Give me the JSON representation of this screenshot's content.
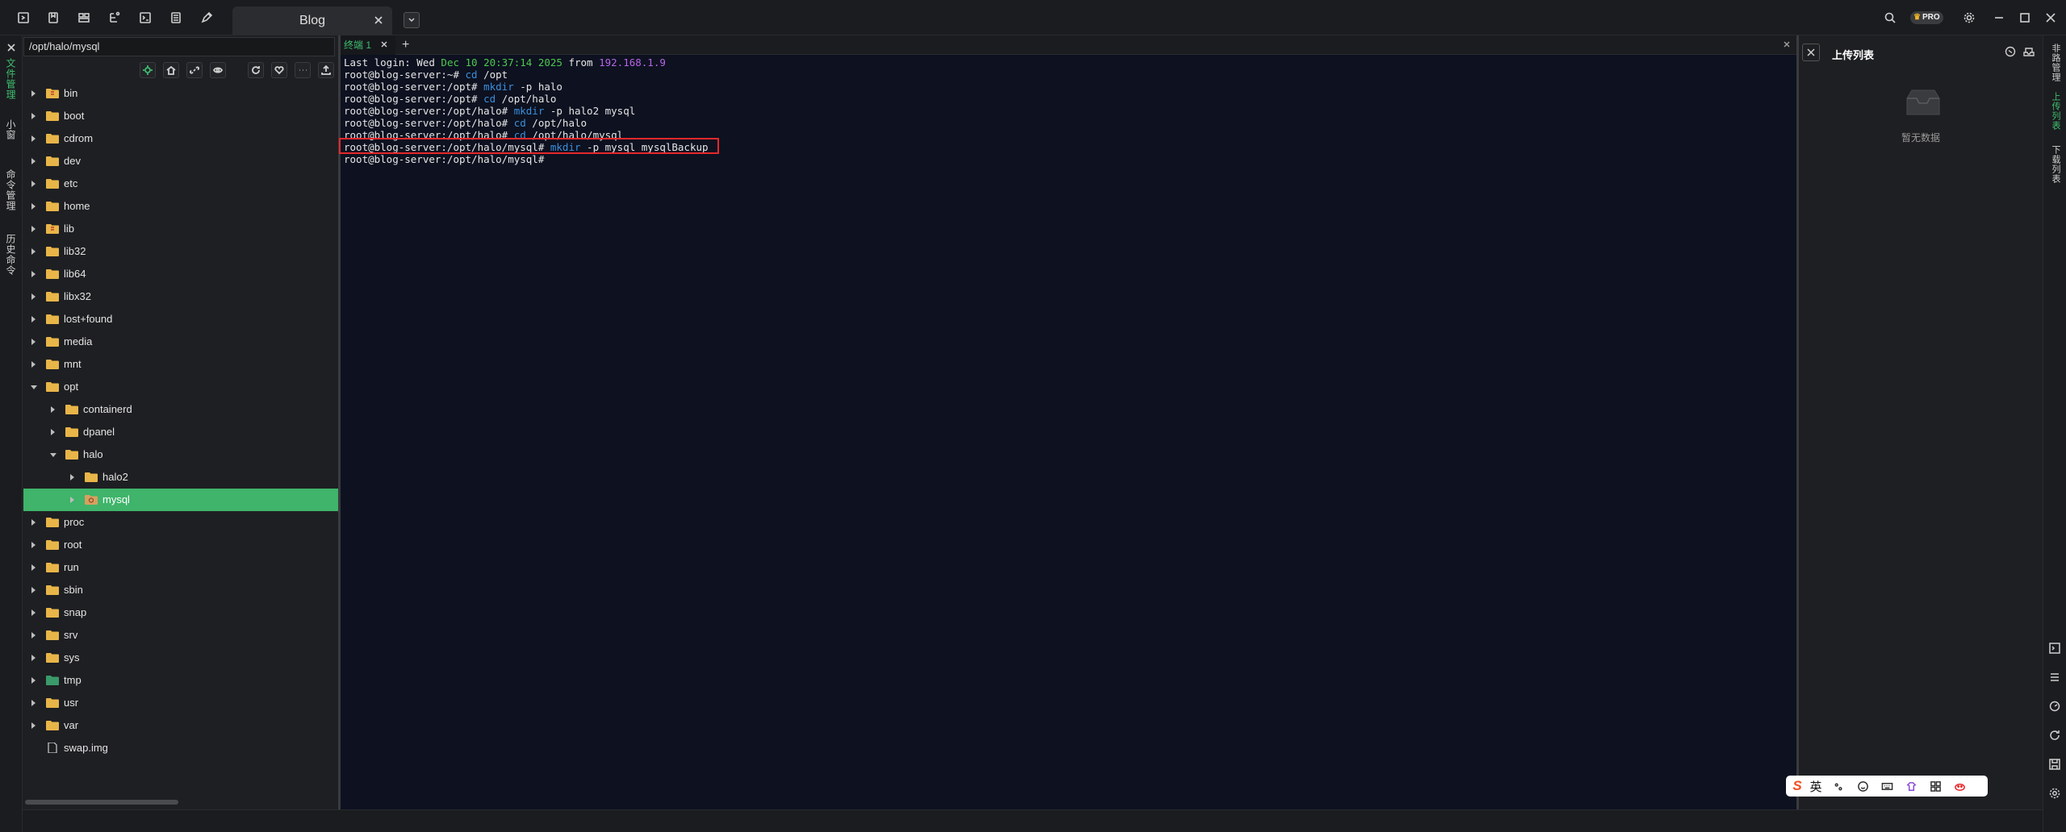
{
  "session_tab": {
    "title": "Blog"
  },
  "pro_badge": "PRO",
  "left_rail": {
    "tabs": [
      {
        "label": "文件管理",
        "active": true
      },
      {
        "label": "小窗",
        "active": false
      },
      {
        "label": "命令管理",
        "active": false
      },
      {
        "label": "历史命令",
        "active": false
      }
    ]
  },
  "file_panel": {
    "path": "/opt/halo/mysql",
    "tree": [
      {
        "name": "bin",
        "depth": 0,
        "expandable": true,
        "expanded": false,
        "type": "folder-link"
      },
      {
        "name": "boot",
        "depth": 0,
        "expandable": true,
        "expanded": false,
        "type": "folder"
      },
      {
        "name": "cdrom",
        "depth": 0,
        "expandable": true,
        "expanded": false,
        "type": "folder"
      },
      {
        "name": "dev",
        "depth": 0,
        "expandable": true,
        "expanded": false,
        "type": "folder"
      },
      {
        "name": "etc",
        "depth": 0,
        "expandable": true,
        "expanded": false,
        "type": "folder"
      },
      {
        "name": "home",
        "depth": 0,
        "expandable": true,
        "expanded": false,
        "type": "folder"
      },
      {
        "name": "lib",
        "depth": 0,
        "expandable": true,
        "expanded": false,
        "type": "folder-link"
      },
      {
        "name": "lib32",
        "depth": 0,
        "expandable": true,
        "expanded": false,
        "type": "folder"
      },
      {
        "name": "lib64",
        "depth": 0,
        "expandable": true,
        "expanded": false,
        "type": "folder"
      },
      {
        "name": "libx32",
        "depth": 0,
        "expandable": true,
        "expanded": false,
        "type": "folder"
      },
      {
        "name": "lost+found",
        "depth": 0,
        "expandable": true,
        "expanded": false,
        "type": "folder"
      },
      {
        "name": "media",
        "depth": 0,
        "expandable": true,
        "expanded": false,
        "type": "folder"
      },
      {
        "name": "mnt",
        "depth": 0,
        "expandable": true,
        "expanded": false,
        "type": "folder"
      },
      {
        "name": "opt",
        "depth": 0,
        "expandable": true,
        "expanded": true,
        "type": "folder"
      },
      {
        "name": "containerd",
        "depth": 1,
        "expandable": true,
        "expanded": false,
        "type": "folder"
      },
      {
        "name": "dpanel",
        "depth": 1,
        "expandable": true,
        "expanded": false,
        "type": "folder"
      },
      {
        "name": "halo",
        "depth": 1,
        "expandable": true,
        "expanded": true,
        "type": "folder"
      },
      {
        "name": "halo2",
        "depth": 2,
        "expandable": true,
        "expanded": false,
        "type": "folder"
      },
      {
        "name": "mysql",
        "depth": 2,
        "expandable": true,
        "expanded": false,
        "type": "folder-special",
        "selected": true
      },
      {
        "name": "proc",
        "depth": 0,
        "expandable": true,
        "expanded": false,
        "type": "folder"
      },
      {
        "name": "root",
        "depth": 0,
        "expandable": true,
        "expanded": false,
        "type": "folder"
      },
      {
        "name": "run",
        "depth": 0,
        "expandable": true,
        "expanded": false,
        "type": "folder"
      },
      {
        "name": "sbin",
        "depth": 0,
        "expandable": true,
        "expanded": false,
        "type": "folder"
      },
      {
        "name": "snap",
        "depth": 0,
        "expandable": true,
        "expanded": false,
        "type": "folder"
      },
      {
        "name": "srv",
        "depth": 0,
        "expandable": true,
        "expanded": false,
        "type": "folder"
      },
      {
        "name": "sys",
        "depth": 0,
        "expandable": true,
        "expanded": false,
        "type": "folder"
      },
      {
        "name": "tmp",
        "depth": 0,
        "expandable": true,
        "expanded": false,
        "type": "folder-sticky"
      },
      {
        "name": "usr",
        "depth": 0,
        "expandable": true,
        "expanded": false,
        "type": "folder"
      },
      {
        "name": "var",
        "depth": 0,
        "expandable": true,
        "expanded": false,
        "type": "folder"
      },
      {
        "name": "swap.img",
        "depth": 0,
        "expandable": false,
        "expanded": false,
        "type": "file"
      }
    ]
  },
  "terminal": {
    "tab_label": "终端 1",
    "lines": [
      [
        {
          "t": "Last login: Wed ",
          "c": ""
        },
        {
          "t": "Dec 10 20:37:14 2025",
          "c": "t-green"
        },
        {
          "t": " from ",
          "c": ""
        },
        {
          "t": "192.168.1.9",
          "c": "t-purple"
        }
      ],
      [
        {
          "t": "root@blog-server:~# ",
          "c": ""
        },
        {
          "t": "cd",
          "c": "t-blue"
        },
        {
          "t": " /opt",
          "c": ""
        }
      ],
      [
        {
          "t": "root@blog-server:/opt# ",
          "c": ""
        },
        {
          "t": "mkdir",
          "c": "t-blue"
        },
        {
          "t": " -p halo",
          "c": ""
        }
      ],
      [
        {
          "t": "root@blog-server:/opt# ",
          "c": ""
        },
        {
          "t": "cd",
          "c": "t-blue"
        },
        {
          "t": " /opt/halo",
          "c": ""
        }
      ],
      [
        {
          "t": "root@blog-server:/opt/halo# ",
          "c": ""
        },
        {
          "t": "mkdir",
          "c": "t-blue"
        },
        {
          "t": " -p halo2 mysql",
          "c": ""
        }
      ],
      [
        {
          "t": "root@blog-server:/opt/halo# ",
          "c": ""
        },
        {
          "t": "cd",
          "c": "t-blue"
        },
        {
          "t": " /opt/halo",
          "c": ""
        }
      ],
      [
        {
          "t": "root@blog-server:/opt/halo# ",
          "c": ""
        },
        {
          "t": "cd",
          "c": "t-blue"
        },
        {
          "t": " /opt/halo/mysql",
          "c": ""
        }
      ],
      [
        {
          "t": "root@blog-server:/opt/halo/mysql# ",
          "c": ""
        },
        {
          "t": "mkdir",
          "c": "t-blue"
        },
        {
          "t": " -p mysql mysqlBackup",
          "c": ""
        }
      ],
      [
        {
          "t": "root@blog-server:/opt/halo/mysql# ",
          "c": ""
        }
      ]
    ]
  },
  "upload_panel": {
    "title": "上传列表",
    "empty_text": "暂无数据"
  },
  "right_rail": {
    "tabs": [
      {
        "label": "非路管理",
        "active": false
      },
      {
        "label": "上传列表",
        "active": true
      },
      {
        "label": "下载列表",
        "active": false
      }
    ]
  },
  "ime": {
    "lang": "英"
  },
  "colors": {
    "accent_green": "#3fb46a",
    "terminal_bg": "#0d1120",
    "highlight_red": "#e5282b",
    "folder_yellow": "#e8b548"
  }
}
